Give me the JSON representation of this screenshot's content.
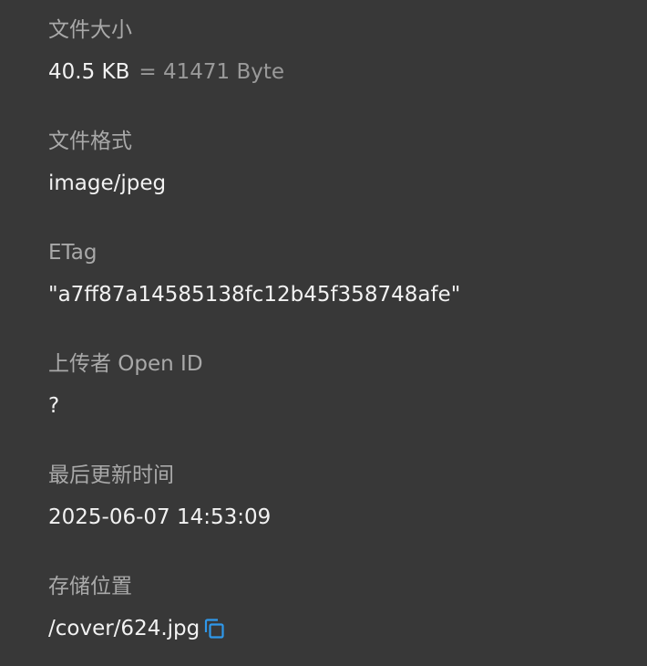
{
  "fields": {
    "file_size": {
      "label": "文件大小",
      "value": "40.5 KB",
      "detail": "= 41471 Byte"
    },
    "file_format": {
      "label": "文件格式",
      "value": "image/jpeg"
    },
    "etag": {
      "label": "ETag",
      "value": "\"a7ff87a14585138fc12b45f358748afe\""
    },
    "uploader_open_id": {
      "label": "上传者 Open ID",
      "value": "?"
    },
    "last_updated": {
      "label": "最后更新时间",
      "value": "2025-06-07 14:53:09"
    },
    "storage_location": {
      "label": "存储位置",
      "value": "/cover/624.jpg",
      "copy_icon": "copy-icon"
    }
  },
  "colors": {
    "background": "#383838",
    "label": "#a9a9a9",
    "value": "#f2f2f2",
    "accent": "#2f98ea"
  }
}
